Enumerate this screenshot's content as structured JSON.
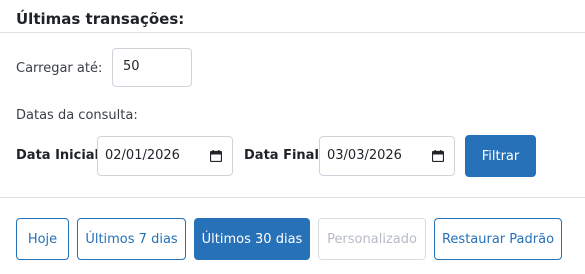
{
  "header": {
    "title": "Últimas transações:"
  },
  "load": {
    "label": "Carregar até:",
    "value": "50"
  },
  "dates": {
    "section_label": "Datas da consulta:",
    "start_label": "Data Inicial:",
    "start_value": "02/01/2026",
    "end_label": "Data Final:",
    "end_value": "03/03/2026",
    "filter_label": "Filtrar"
  },
  "ranges": {
    "today": "Hoje",
    "last7": "Últimos 7 dias",
    "last30": "Últimos 30 dias",
    "custom": "Personalizado",
    "reset": "Restaurar Padrão",
    "active": "last30"
  },
  "colors": {
    "primary": "#2671b8",
    "divider": "#dee2e6",
    "disabled": "#b6bcc3"
  },
  "icons": {
    "calendar": "calendar-icon"
  }
}
